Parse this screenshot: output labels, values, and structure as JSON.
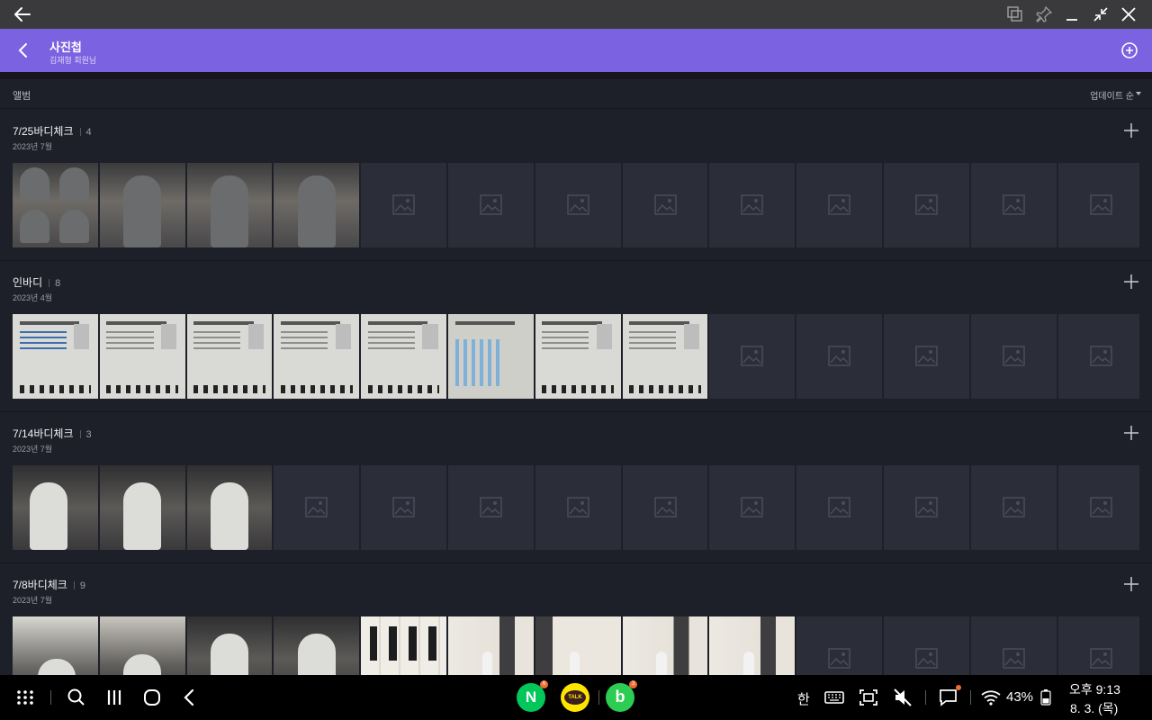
{
  "app_bar": {
    "title": "사진첩",
    "subtitle": "김재형 회원님"
  },
  "list_header": {
    "label": "앨범",
    "sort": "업데이트 순"
  },
  "albums": [
    {
      "name": "7/25바디체크",
      "count": "4",
      "date": "2023년 7월"
    },
    {
      "name": "인바디",
      "count": "8",
      "date": "2023년 4월"
    },
    {
      "name": "7/14바디체크",
      "count": "3",
      "date": "2023년 7월"
    },
    {
      "name": "7/8바디체크",
      "count": "9",
      "date": "2023년 7월"
    }
  ],
  "dock": {
    "apps": [
      {
        "name": "naver",
        "letter": "N",
        "badge": "6",
        "color": "#03c75a"
      },
      {
        "name": "kakaotalk",
        "letter": "TALK",
        "badge": "",
        "color": "#fee500"
      },
      {
        "name": "band",
        "letter": "b",
        "badge": "3",
        "color": "#2dcc52"
      }
    ],
    "ime": "한",
    "battery": "43%",
    "time": "오후 9:13",
    "date": "8. 3. (목)"
  },
  "colors": {
    "accent": "#7b62e0",
    "background": "#1e2029",
    "placeholder": "#2b2d38"
  }
}
